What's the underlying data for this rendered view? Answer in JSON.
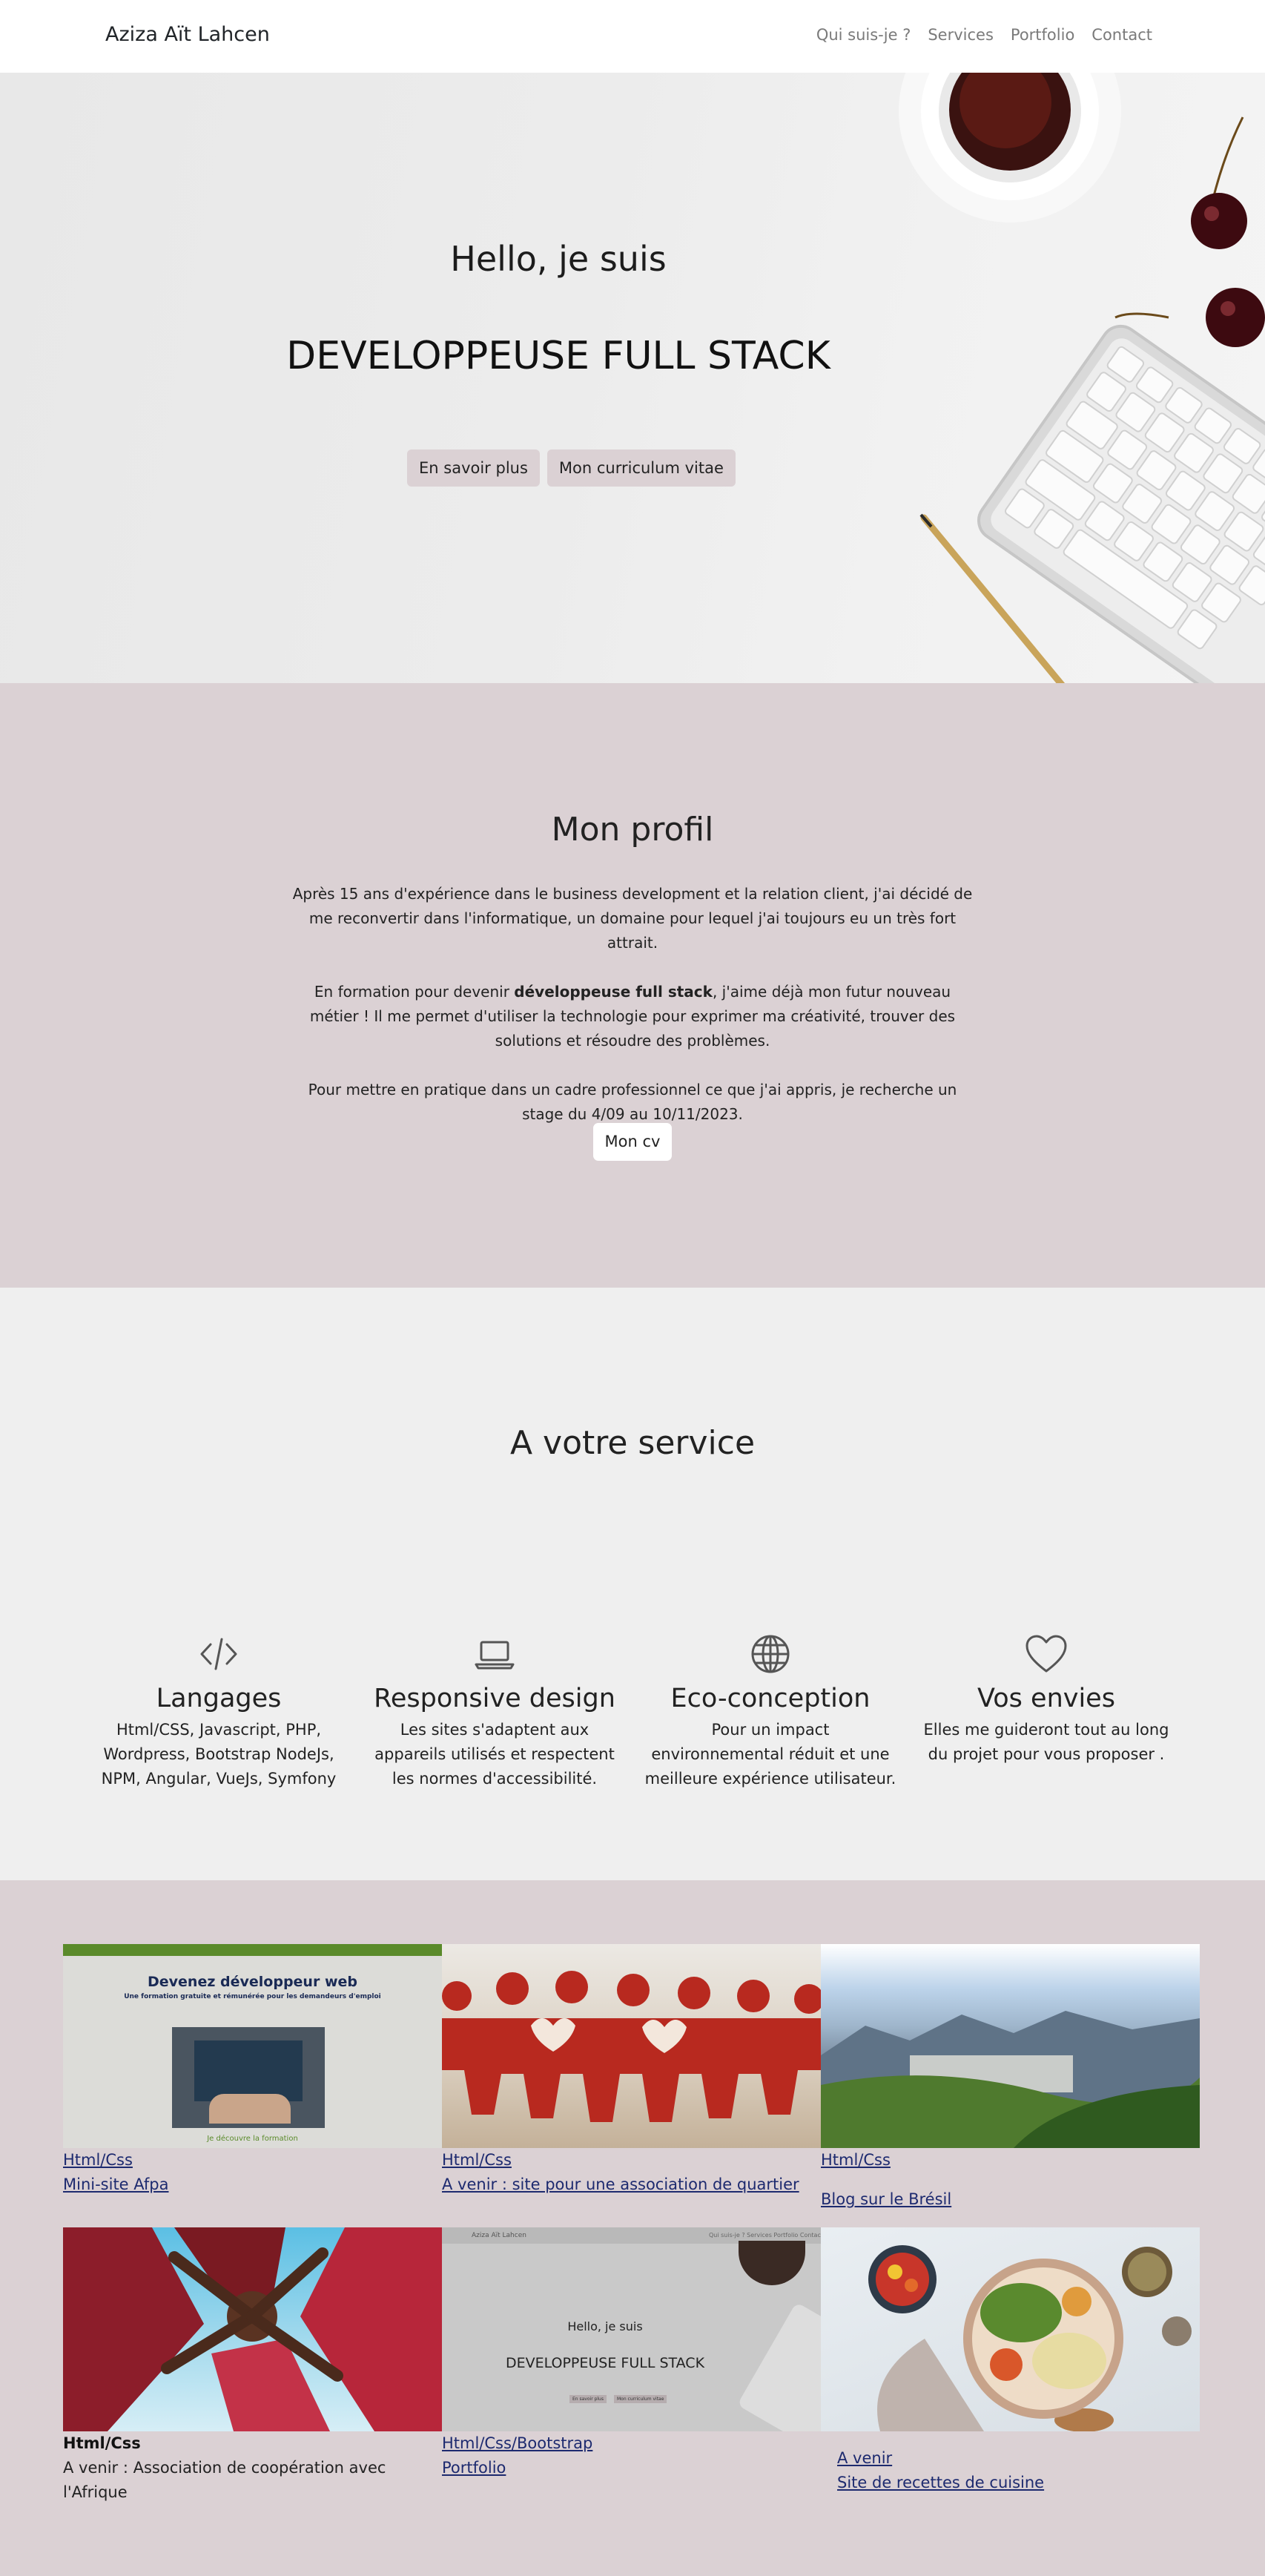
{
  "nav": {
    "brand": "Aziza Aït Lahcen",
    "links": [
      "Qui suis-je ?",
      "Services",
      "Portfolio",
      "Contact"
    ]
  },
  "hero": {
    "title": "Hello, je suis",
    "subtitle": "DEVELOPPEUSE FULL STACK",
    "buttons": [
      "En savoir plus",
      "Mon curriculum vitae"
    ]
  },
  "profil": {
    "title": "Mon profil",
    "p1": "Après 15 ans d'expérience dans le business development et la relation client, j'ai décidé de me reconvertir dans l'informatique, un domaine pour lequel j'ai toujours eu un très fort attrait.",
    "p2_before": "En formation pour devenir ",
    "p2_bold": "développeuse full stack",
    "p2_after": ", j'aime déjà mon futur nouveau métier ! Il me permet d'utiliser la technologie pour exprimer ma créativité, trouver des solutions et résoudre des problèmes.",
    "p3": "Pour mettre en pratique dans un cadre professionnel ce que j'ai appris, je recherche un stage du 4/09 au 10/11/2023.",
    "button": "Mon cv"
  },
  "services": {
    "title": "A votre service",
    "items": [
      {
        "icon": "code-icon",
        "title": "Langages",
        "text": "Html/CSS, Javascript, PHP, Wordpress, Bootstrap NodeJs, NPM, Angular, VueJs, Symfony"
      },
      {
        "icon": "laptop-icon",
        "title": "Responsive design",
        "text": "Les sites s'adaptent aux appareils utilisés et respectent les normes d'accessibilité."
      },
      {
        "icon": "globe-icon",
        "title": "Eco-conception",
        "text": "Pour un impact environnemental réduit et une meilleure expérience utilisateur."
      },
      {
        "icon": "heart-icon",
        "title": "Vos envies",
        "text": "Elles me guideront tout au long du projet pour vous proposer ."
      }
    ]
  },
  "portfolio": {
    "items": [
      {
        "tag": "Html/Css",
        "link": "Mini-site Afpa",
        "thumb_title": "Devenez développeur web",
        "thumb_sub": "Une formation gratuite et rémunérée pour les demandeurs d'emploi",
        "thumb_cta": "Je découvre la formation"
      },
      {
        "tag": "Html/Css",
        "link": "A venir : site pour une association de quartier"
      },
      {
        "tag": "Html/Css",
        "link": "Blog sur le Brésil"
      },
      {
        "tag": "Html/Css",
        "desc": "A venir : Association de coopération avec l'Afrique"
      },
      {
        "tag": "Html/Css/Bootstrap",
        "link": "Portfolio",
        "thumb_brand": "Aziza Aït Lahcen",
        "thumb_nav": "Qui suis-je ? Services Portfolio Contact",
        "thumb_title": "Hello, je suis",
        "thumb_sub": "DEVELOPPEUSE FULL STACK",
        "thumb_btn1": "En savoir plus",
        "thumb_btn2": "Mon curriculum vitae"
      },
      {
        "link1": "A venir",
        "link": "Site de recettes de cuisine"
      }
    ]
  },
  "colors": {
    "accent": "#dbd1d4",
    "section_light": "#efefef",
    "link": "#1d2a6f"
  }
}
